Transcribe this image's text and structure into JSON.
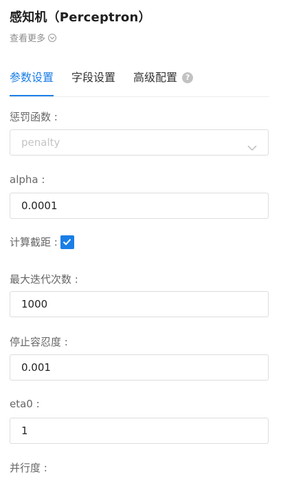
{
  "header": {
    "title": "感知机（Perceptron）",
    "more_label": "查看更多"
  },
  "tabs": [
    {
      "label": "参数设置",
      "active": true
    },
    {
      "label": "字段设置",
      "active": false
    },
    {
      "label": "高级配置",
      "active": false,
      "help_icon": "question-circle-icon"
    }
  ],
  "form": {
    "penalty": {
      "label": "惩罚函数 :",
      "placeholder": "penalty"
    },
    "alpha": {
      "label": "alpha :",
      "value": "0.0001"
    },
    "fit_intercept": {
      "label": "计算截距 :",
      "checked": true
    },
    "max_iter": {
      "label": "最大迭代次数 :",
      "value": "1000"
    },
    "tol": {
      "label": "停止容忍度 :",
      "value": "0.001"
    },
    "eta0": {
      "label": "eta0 :",
      "value": "1"
    },
    "n_jobs": {
      "label": "并行度 :"
    }
  },
  "colors": {
    "accent": "#1a7ee6",
    "border": "#dcdcdc",
    "label": "#666666"
  }
}
